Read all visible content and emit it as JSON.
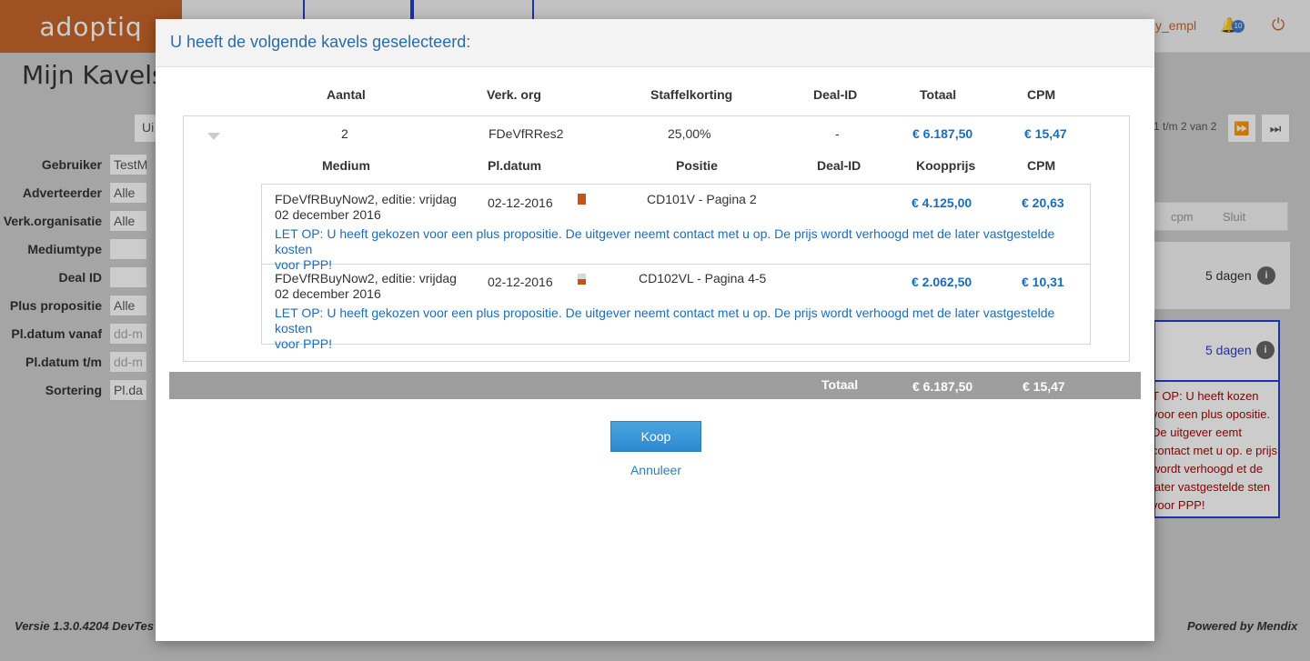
{
  "app": {
    "logo": "adoptiq",
    "user": "y_empl",
    "notification_count": "10",
    "page_title": "Mijn Kavels",
    "uit_button": "Ui",
    "filters": [
      {
        "label": "Gebruiker",
        "value": "TestM"
      },
      {
        "label": "Adverteerder",
        "value": "Alle"
      },
      {
        "label": "Verk.organisatie",
        "value": "Alle"
      },
      {
        "label": "Mediumtype",
        "value": ""
      },
      {
        "label": "Deal ID",
        "value": ""
      },
      {
        "label": "Plus propositie",
        "value": "Alle"
      },
      {
        "label": "Pl.datum vanaf",
        "value": "dd-m"
      },
      {
        "label": "Pl.datum t/m",
        "value": "dd-m"
      },
      {
        "label": "Sortering",
        "value": "Pl.da"
      }
    ],
    "pager_text": "1 t/m 2 van 2",
    "column_headers": [
      "cpm",
      "Sluit"
    ],
    "days_1": "5 dagen",
    "days_2": "5 dagen",
    "warning": "T OP: U heeft kozen voor een plus opositie. De uitgever eemt contact met u op. e prijs wordt verhoogd et de later vastgestelde sten voor PPP!",
    "footer_left": "Versie 1.3.0.4204 DevTes",
    "footer_right": "Powered by Mendix"
  },
  "modal": {
    "title": "U heeft de volgende kavels geselecteerd:",
    "headers": {
      "aantal": "Aantal",
      "verk_org": "Verk. org",
      "staffelkorting": "Staffelkorting",
      "deal_id": "Deal-ID",
      "totaal": "Totaal",
      "cpm": "CPM"
    },
    "group": {
      "aantal": "2",
      "verk_org": "FDeVfRRes2",
      "staffelkorting": "25,00%",
      "deal_id": "-",
      "totaal": "€ 6.187,50",
      "cpm": "€ 15,47"
    },
    "item_headers": {
      "medium": "Medium",
      "pl_datum": "Pl.datum",
      "positie": "Positie",
      "deal_id": "Deal-ID",
      "koopprijs": "Koopprijs",
      "cpm": "CPM"
    },
    "items": [
      {
        "medium_line1": "FDeVfRBuyNow2, editie: vrijdag",
        "medium_line2": "02 december 2016",
        "pl_datum": "02-12-2016",
        "positie": "CD101V - Pagina 2",
        "koopprijs": "€ 4.125,00",
        "cpm": "€ 20,63",
        "note_line1": "LET OP: U heeft gekozen voor een plus propositie. De uitgever neemt contact met u op. De prijs wordt verhoogd met de later vastgestelde kosten",
        "note_line2": "voor PPP!"
      },
      {
        "medium_line1": "FDeVfRBuyNow2, editie: vrijdag",
        "medium_line2": "02 december 2016",
        "pl_datum": "02-12-2016",
        "positie": "CD102VL - Pagina 4-5",
        "koopprijs": "€ 2.062,50",
        "cpm": "€ 10,31",
        "note_line1": "LET OP: U heeft gekozen voor een plus propositie. De uitgever neemt contact met u op. De prijs wordt verhoogd met de later vastgestelde kosten",
        "note_line2": "voor PPP!"
      }
    ],
    "total": {
      "label": "Totaal",
      "totaal": "€ 6.187,50",
      "cpm": "€ 15,47"
    },
    "koop_label": "Koop",
    "annuleer_label": "Annuleer"
  },
  "colors": {
    "brand": "#c8662a",
    "accent_blue": "#1a6cc0",
    "button_blue": "#2d8ad0",
    "total_bar": "#9e9e9e",
    "warning_red": "#b30000"
  }
}
